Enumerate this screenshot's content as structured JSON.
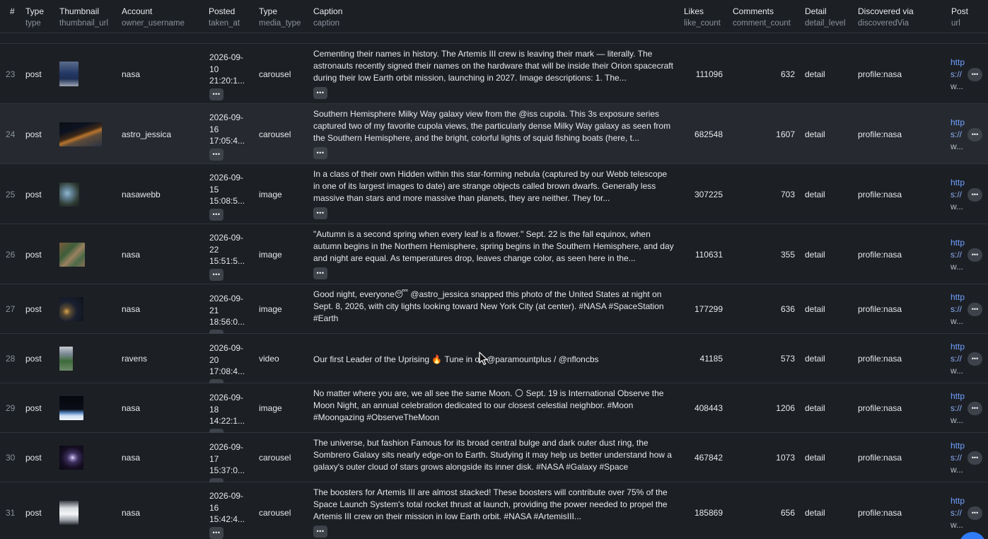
{
  "header": {
    "num": "#",
    "type": {
      "title": "Type",
      "sub": "type"
    },
    "thumb": {
      "title": "Thumbnail",
      "sub": "thumbnail_url"
    },
    "account": {
      "title": "Account",
      "sub": "owner_username"
    },
    "posted": {
      "title": "Posted",
      "sub": "taken_at"
    },
    "media": {
      "title": "Type",
      "sub": "media_type"
    },
    "caption": {
      "title": "Caption",
      "sub": "caption"
    },
    "likes": {
      "title": "Likes",
      "sub": "like_count"
    },
    "comments": {
      "title": "Comments",
      "sub": "comment_count"
    },
    "detail": {
      "title": "Detail",
      "sub": "detail_level"
    },
    "discovered": {
      "title": "Discovered via",
      "sub": "discoveredVia"
    },
    "post": {
      "title": "Post",
      "sub": "url"
    }
  },
  "rows": [
    {
      "num": "23",
      "type": "post",
      "account": "nasa",
      "date": [
        "2026-09-",
        "10",
        "21:20:1..."
      ],
      "media": "carousel",
      "caption": "Cementing their names in history. The Artemis III crew is leaving their mark — literally. The astronauts recently signed their names on the hardware that will be inside their Orion spacecraft during their low Earth orbit mission, launching in 2027. Image descriptions: 1. The...",
      "likes": "111096",
      "comments": "632",
      "detail": "detail",
      "discovered": "profile:nasa",
      "url": [
        "http",
        "s://",
        "w..."
      ],
      "thumb": "crew-photo"
    },
    {
      "num": "24",
      "type": "post",
      "account": "astro_jessica",
      "date": [
        "2026-09-",
        "16",
        "17:05:4..."
      ],
      "media": "carousel",
      "caption": "Southern Hemisphere Milky Way galaxy view from the @iss cupola. This 3s exposure series captured two of my favorite cupola views, the particularly dense Milky Way galaxy as seen from the Southern Hemisphere, and the bright, colorful lights of squid fishing boats (here, t...",
      "likes": "682548",
      "comments": "1607",
      "detail": "detail",
      "discovered": "profile:nasa",
      "url": [
        "http",
        "s://",
        "w..."
      ],
      "thumb": "earth-horizon"
    },
    {
      "num": "25",
      "type": "post",
      "account": "nasawebb",
      "date": [
        "2026-09-",
        "15",
        "15:08:5..."
      ],
      "media": "image",
      "caption": "In a class of their own Hidden within this star-forming nebula (captured by our Webb telescope in one of its largest images to date) are strange objects called brown dwarfs. Generally less massive than stars and more massive than planets, they are neither. They for...",
      "likes": "307225",
      "comments": "703",
      "detail": "detail",
      "discovered": "profile:nasa",
      "url": [
        "http",
        "s://",
        "w..."
      ],
      "thumb": "nebula"
    },
    {
      "num": "26",
      "type": "post",
      "account": "nasa",
      "date": [
        "2026-09-",
        "22",
        "15:51:5..."
      ],
      "media": "image",
      "caption": "\"Autumn is a second spring when every leaf is a flower.\" Sept. 22 is the fall equinox, when autumn begins in the Northern Hemisphere, spring begins in the Southern Hemisphere, and day and night are equal. As temperatures drop, leaves change color, as seen here in the...",
      "likes": "110631",
      "comments": "355",
      "detail": "detail",
      "discovered": "profile:nasa",
      "url": [
        "http",
        "s://",
        "w..."
      ],
      "thumb": "autumn-land"
    },
    {
      "num": "27",
      "type": "post",
      "account": "nasa",
      "date": [
        "2026-09-",
        "21",
        "18:56:0..."
      ],
      "media": "image",
      "caption": "Good night, everyone😴  @astro_jessica snapped this photo of the United States at night on Sept. 8, 2026, with city lights looking toward New York City (at center).  #NASA #SpaceStation #Earth",
      "likes": "177299",
      "comments": "636",
      "detail": "detail",
      "discovered": "profile:nasa",
      "url": [
        "http",
        "s://",
        "w..."
      ],
      "thumb": "night-lights"
    },
    {
      "num": "28",
      "type": "post",
      "account": "ravens",
      "date": [
        "2026-09-",
        "20",
        "17:08:4..."
      ],
      "media": "video",
      "caption": "Our first Leader of the Uprising 🔥 Tune in on @paramountplus / @nfloncbs",
      "likes": "41185",
      "comments": "573",
      "detail": "detail",
      "discovered": "profile:nasa",
      "url": [
        "http",
        "s://",
        "w..."
      ],
      "thumb": "football"
    },
    {
      "num": "29",
      "type": "post",
      "account": "nasa",
      "date": [
        "2026-09-",
        "18",
        "14:22:1..."
      ],
      "media": "image",
      "caption": "No matter where you are, we all see the same Moon. 🌕 Sept. 19 is International Observe the Moon Night, an annual celebration dedicated to our closest celestial neighbor. #Moon #Moongazing #ObserveTheMoon",
      "likes": "408443",
      "comments": "1206",
      "detail": "detail",
      "discovered": "profile:nasa",
      "url": [
        "http",
        "s://",
        "w..."
      ],
      "thumb": "moon-earth"
    },
    {
      "num": "30",
      "type": "post",
      "account": "nasa",
      "date": [
        "2026-09-",
        "17",
        "15:37:0..."
      ],
      "media": "carousel",
      "caption": "The universe, but fashion Famous for its broad central bulge and dark outer dust ring, the Sombrero Galaxy sits nearly edge-on to Earth. Studying it may help us better understand how a galaxy's outer cloud of stars grows alongside its inner disk. #NASA #Galaxy #Space",
      "likes": "467842",
      "comments": "1073",
      "detail": "detail",
      "discovered": "profile:nasa",
      "url": [
        "http",
        "s://",
        "w..."
      ],
      "thumb": "galaxy"
    },
    {
      "num": "31",
      "type": "post",
      "account": "nasa",
      "date": [
        "2026-09-",
        "16",
        "15:42:4..."
      ],
      "media": "carousel",
      "caption": "The boosters for Artemis III are almost stacked!  These boosters will contribute over 75% of the Space Launch System's total rocket thrust at launch, providing the power needed to propel the Artemis III crew on their mission in low Earth orbit.  #NASA #ArtemisIII...",
      "likes": "185869",
      "comments": "656",
      "detail": "detail",
      "discovered": "profile:nasa",
      "url": [
        "http",
        "s://",
        "w..."
      ],
      "thumb": "boosters"
    }
  ]
}
